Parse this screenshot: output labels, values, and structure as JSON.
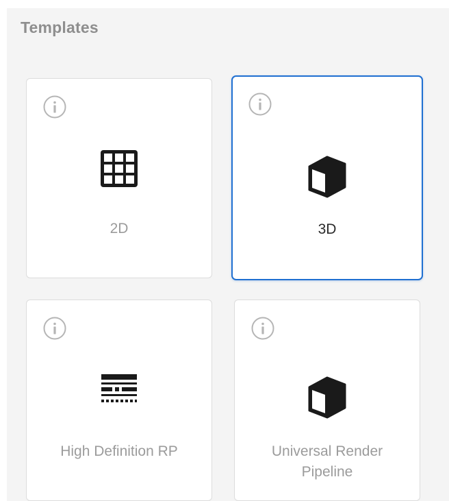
{
  "panel": {
    "title": "Templates"
  },
  "templates": [
    {
      "label_line1": "2D",
      "label_line2": "",
      "icon": "grid-icon",
      "selected": false
    },
    {
      "label_line1": "3D",
      "label_line2": "",
      "icon": "cube-icon",
      "selected": true
    },
    {
      "label_line1": "High Definition RP",
      "label_line2": "",
      "icon": "hdrp-icon",
      "selected": false
    },
    {
      "label_line1": "Universal Render",
      "label_line2": "Pipeline",
      "icon": "cube-icon",
      "selected": false
    }
  ],
  "colors": {
    "selected_border": "#1f6fd1",
    "panel_background": "#f4f4f4",
    "card_border": "#dcdcdc",
    "muted_text": "#9b9b9b",
    "icon": "#1a1a1a"
  }
}
